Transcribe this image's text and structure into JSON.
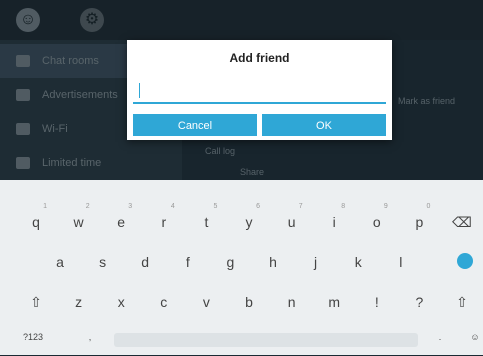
{
  "app": {
    "sidebar_items": [
      {
        "label": "Chat rooms",
        "icon": "chat-icon",
        "selected": true
      },
      {
        "label": "Advertisements",
        "icon": "ad-icon",
        "selected": false
      },
      {
        "label": "Wi-Fi",
        "icon": "wifi-icon",
        "selected": false
      },
      {
        "label": "Limited time",
        "icon": "clock-icon",
        "selected": false
      }
    ],
    "right_texts": [
      "Mark as friend",
      "Call log",
      "Share"
    ]
  },
  "dialog": {
    "title": "Add friend",
    "input_value": "",
    "input_placeholder": "",
    "cancel_label": "Cancel",
    "ok_label": "OK"
  },
  "keyboard": {
    "row1": [
      {
        "ch": "q",
        "hint": "1"
      },
      {
        "ch": "w",
        "hint": "2"
      },
      {
        "ch": "e",
        "hint": "3"
      },
      {
        "ch": "r",
        "hint": "4"
      },
      {
        "ch": "t",
        "hint": "5"
      },
      {
        "ch": "y",
        "hint": "6"
      },
      {
        "ch": "u",
        "hint": "7"
      },
      {
        "ch": "i",
        "hint": "8"
      },
      {
        "ch": "o",
        "hint": "9"
      },
      {
        "ch": "p",
        "hint": "0"
      },
      {
        "ch": "⌫",
        "hint": ""
      }
    ],
    "row2": [
      {
        "ch": "a"
      },
      {
        "ch": "s"
      },
      {
        "ch": "d"
      },
      {
        "ch": "f"
      },
      {
        "ch": "g"
      },
      {
        "ch": "h"
      },
      {
        "ch": "j"
      },
      {
        "ch": "k"
      },
      {
        "ch": "l"
      }
    ],
    "row3": [
      {
        "ch": "⇧"
      },
      {
        "ch": "z"
      },
      {
        "ch": "x"
      },
      {
        "ch": "c"
      },
      {
        "ch": "v"
      },
      {
        "ch": "b"
      },
      {
        "ch": "n"
      },
      {
        "ch": "m"
      },
      {
        "ch": "!"
      },
      {
        "ch": "?"
      },
      {
        "ch": "⇧"
      }
    ],
    "row4": [
      {
        "ch": "?123"
      },
      {
        "ch": ","
      },
      {
        "ch": "."
      },
      {
        "ch": "☺"
      }
    ],
    "accent_color": "#2fa7d6"
  }
}
